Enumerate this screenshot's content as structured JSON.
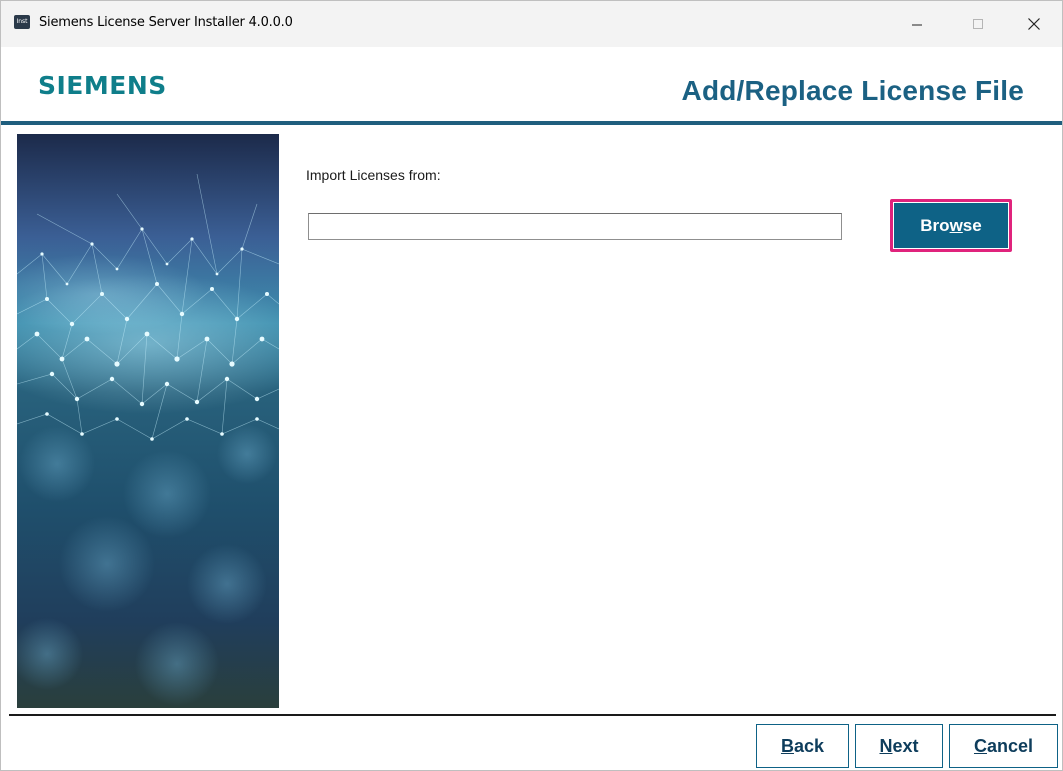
{
  "window": {
    "title": "Siemens License Server Installer 4.0.0.0",
    "icon_text": "Inst"
  },
  "header": {
    "logo": "SIEMENS",
    "page_title": "Add/Replace License File"
  },
  "main": {
    "import_label": "Import Licenses from:",
    "path_value": "",
    "browse": {
      "pre": "Bro",
      "mnemonic": "w",
      "post": "se"
    }
  },
  "footer": {
    "back": {
      "mnemonic": "B",
      "rest": "ack"
    },
    "next": {
      "mnemonic": "N",
      "rest": "ext"
    },
    "cancel": {
      "mnemonic": "C",
      "rest": "ancel"
    }
  },
  "colors": {
    "brand_teal": "#0f7e8a",
    "title_blue": "#1b6183",
    "button_blue": "#0e6286",
    "highlight_pink": "#e0237c"
  }
}
